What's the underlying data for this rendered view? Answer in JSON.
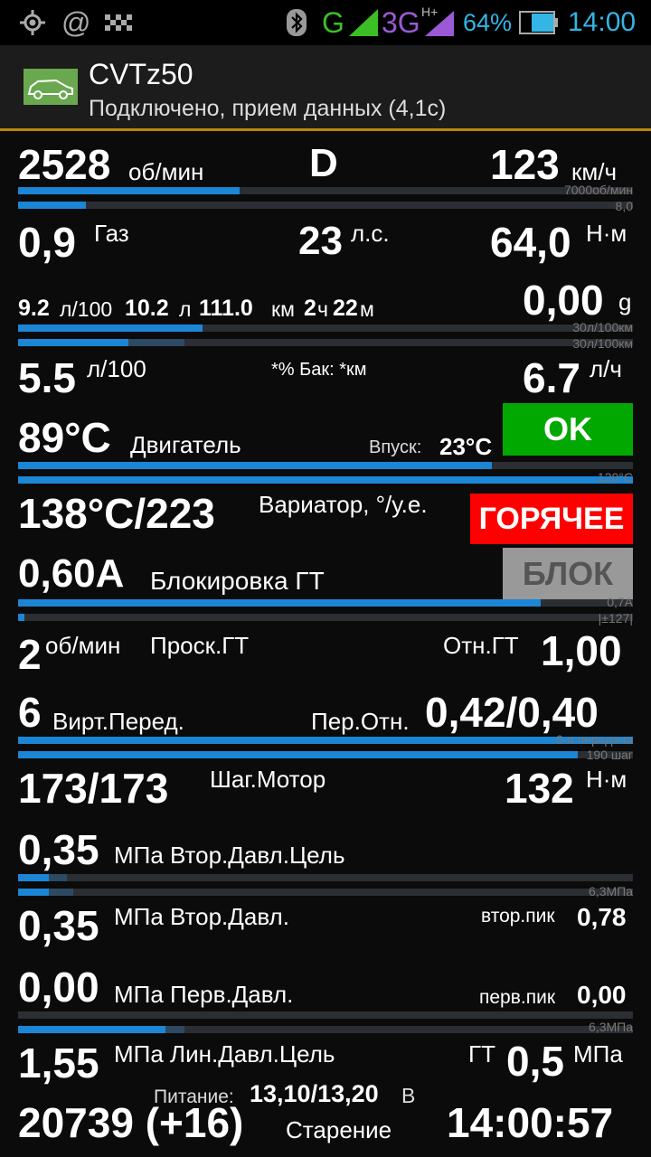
{
  "statusbar": {
    "network_type": "G",
    "network_3g": "3G",
    "network_hplus": "H+",
    "battery_percent": "64%",
    "clock": "14:00",
    "colors": {
      "green": "#3bbf24",
      "purple": "#9b59d6",
      "blue": "#33b5e5"
    }
  },
  "appbar": {
    "title": "CVTz50",
    "subtitle": "Подключено, прием данных (4,1с)"
  },
  "row1": {
    "rpm_value": "2528",
    "rpm_unit": "об/мин",
    "gear": "D",
    "speed_value": "123",
    "speed_unit": "км/ч"
  },
  "bar_rpm": {
    "level": 0.36,
    "scale": "7000об/мин"
  },
  "bar_accel": {
    "level": 0.11,
    "scale": "8,0"
  },
  "row2": {
    "gas_value": "0,9",
    "gas_label": "Газ",
    "power_value": "23",
    "power_unit": "л.с.",
    "torque_value": "64,0",
    "torque_unit": "Н·м"
  },
  "row3": {
    "consumption_value": "9.2",
    "consumption_unit": "л/100",
    "fuel_used_value": "10.2",
    "fuel_used_unit": "л",
    "distance_value": "111.0",
    "distance_unit": "км",
    "trip_hours": "2",
    "trip_hours_unit": "ч",
    "trip_minutes": "22",
    "trip_minutes_unit": "м",
    "g_value": "0,00",
    "g_unit": "g"
  },
  "bar_cons1": {
    "level": 0.3,
    "scale": "30л/100км"
  },
  "bar_cons2": {
    "level": 0.18,
    "ghost": 0.27,
    "scale": "30л/100км"
  },
  "row4": {
    "inst_value": "5.5",
    "inst_unit": "л/100",
    "tank_text": "*% Бак: *км",
    "hourly_value": "6.7",
    "hourly_unit": "л/ч"
  },
  "row5": {
    "engine_temp": "89°C",
    "engine_label": "Двигатель",
    "intake_label": "Впуск:",
    "intake_temp": "23°C",
    "status_badge": "OK",
    "status_color": "#00a800"
  },
  "bar_temp1": {
    "level": 0.77
  },
  "bar_temp2": {
    "level": 1.0,
    "scale": "120°C"
  },
  "row6": {
    "cvt_temp": "138°C/223",
    "cvt_label": "Вариатор, °/у.е.",
    "hot_badge": "ГОРЯЧЕЕ",
    "hot_color": "#ff0000"
  },
  "row7": {
    "lockup_value": "0,60A",
    "lockup_label": "Блокировка ГТ",
    "lock_badge": "БЛОК",
    "lock_color": "#999999"
  },
  "bar_lock1": {
    "level": 0.85,
    "scale": "0,7A"
  },
  "bar_lock2": {
    "level": 0.01,
    "scale": "|±127|"
  },
  "row8": {
    "slip_value": "2",
    "slip_unit": "об/мин",
    "slip_label": "Проск.ГТ",
    "ratio_label": "Отн.ГТ",
    "ratio_value": "1,00"
  },
  "row9": {
    "vgear_value": "6",
    "vgear_label": "Вирт.Перед.",
    "trans_label": "Пер.Отн.",
    "trans_value": "0,42/0,40"
  },
  "bar_gear": {
    "level": 1.0,
    "scale": "6-я передача"
  },
  "bar_step": {
    "level": 0.91,
    "scale": "190 шаг"
  },
  "row10": {
    "step_value": "173/173",
    "step_label": "Шаг.Мотор",
    "torque2_value": "132",
    "torque2_unit": "Н·м"
  },
  "row11": {
    "sec_target_value": "0,35",
    "sec_target_label": "МПа Втор.Давл.Цель"
  },
  "bar_sec1": {
    "level": 0.05,
    "ghost": 0.08
  },
  "bar_sec2": {
    "level": 0.05,
    "ghost": 0.09,
    "scale": "6,3МПа"
  },
  "row12": {
    "sec_value": "0,35",
    "sec_label": "МПа Втор.Давл.",
    "sec_peak_label": "втор.пик",
    "sec_peak_value": "0,78"
  },
  "row13": {
    "prim_value": "0,00",
    "prim_label": "МПа Перв.Давл.",
    "prim_peak_label": "перв.пик",
    "prim_peak_value": "0,00"
  },
  "bar_prim1": {
    "level": 0.0
  },
  "bar_prim2": {
    "level": 0.24,
    "ghost": 0.27,
    "scale": "6,3МПа"
  },
  "row14": {
    "line_value": "1,55",
    "line_label": "МПа Лин.Давл.Цель",
    "tc_label": "ГТ",
    "tc_value": "0,5",
    "tc_unit": "МПа"
  },
  "row15": {
    "supply_label": "Питание:",
    "supply_value": "13,10/13,20",
    "supply_unit": "В"
  },
  "row16": {
    "aging_value": "20739 (+16)",
    "aging_label": "Старение",
    "time_value": "14:00:57"
  }
}
